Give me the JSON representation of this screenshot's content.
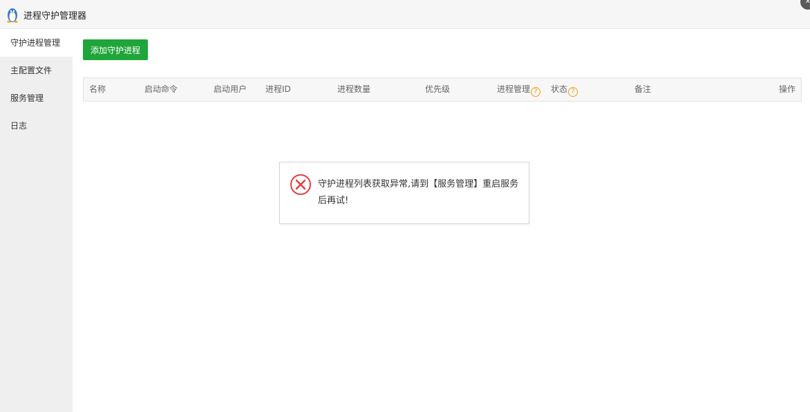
{
  "window": {
    "title": "进程守护管理器",
    "logo_icon": "linux-penguin-icon",
    "close_icon": "close-icon"
  },
  "sidebar": {
    "items": [
      {
        "label": "守护进程管理",
        "active": true
      },
      {
        "label": "主配置文件",
        "active": false
      },
      {
        "label": "服务管理",
        "active": false
      },
      {
        "label": "日志",
        "active": false
      }
    ]
  },
  "toolbar": {
    "add_label": "添加守护进程",
    "add_color": "#20a53a"
  },
  "table": {
    "columns": [
      "名称",
      "启动命令",
      "启动用户",
      "进程ID",
      "进程数量",
      "优先级",
      "进程管理",
      "状态",
      "备注",
      "操作"
    ],
    "help_mark": "?",
    "rows": []
  },
  "error": {
    "icon": "error-circle-x-icon",
    "message": "守护进程列表获取异常,请到【服务管理】重启服务后再试!",
    "color": "#e4393c"
  }
}
